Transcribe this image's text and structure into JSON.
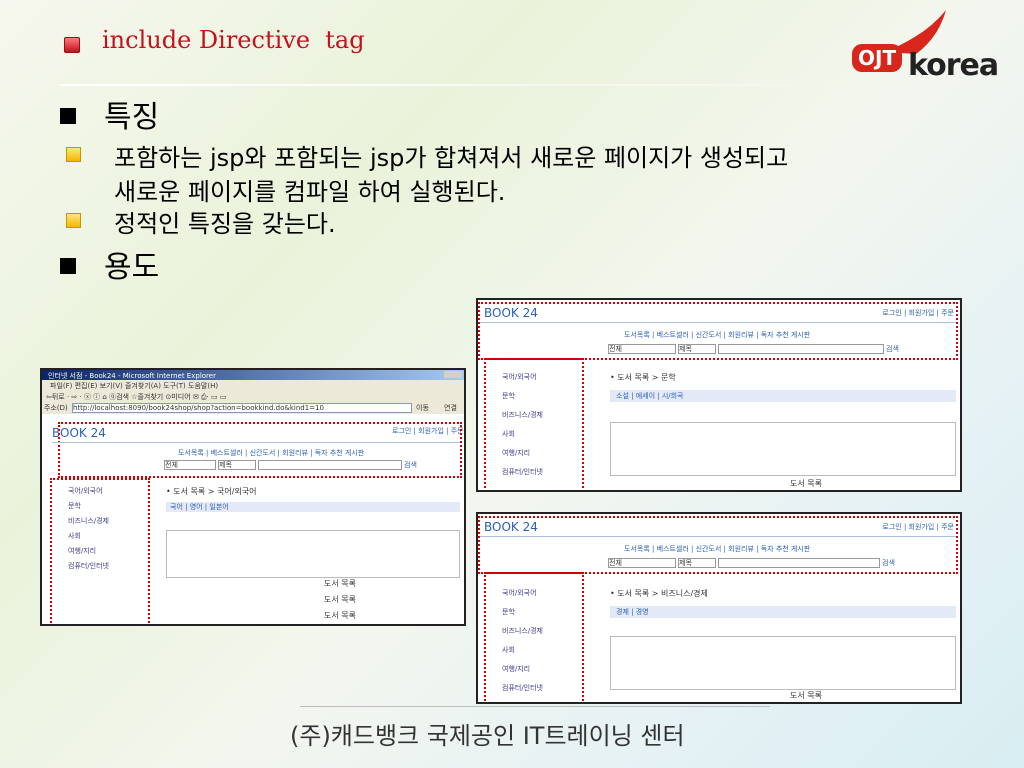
{
  "header": {
    "title": "include Directive  tag",
    "logo_left": "OJT",
    "logo_right": "korea"
  },
  "body": {
    "section1": "특징",
    "point1_line1": "포함하는 jsp와 포함되는 jsp가 합쳐져서 새로운 페이지가 생성되고",
    "point1_line2": "새로운 페이지를 컴파일 하여 실행된다.",
    "point2": "정적인 특징을 갖는다.",
    "section2": "용도"
  },
  "browser": {
    "window_title": "인터넷 서점 - Book24 - Microsoft Internet Explorer",
    "menu": "파일(F)  편집(E)  보기(V)  즐겨찾기(A)  도구(T)  도움말(H)",
    "toolbar": "⇦뒤로 · ⇨ · ⓧ ⓘ ⌂  ⓠ검색  ☆즐겨찾기  ⊙미디어  ✉ ⎙· ▭ ▭",
    "address_label": "주소(D)",
    "address": "http://localhost:8090/book24shop/shop?action=bookkind.do&kind1=10",
    "go_button": "이동",
    "links_button": "연결"
  },
  "site": {
    "logo": "BOOK 24",
    "top_links": "로그인 | 회원가입 | 주문",
    "nav": "도서목록   |   베스트셀러   |   신간도서   |   회원리뷰   |   독자 추천 게시판",
    "search_select1": "전체",
    "search_select2": "제목",
    "search_button": "검색",
    "categories": [
      "국어/외국어",
      "문학",
      "비즈니스/경제",
      "사회",
      "여행/지리",
      "컴퓨터/인터넷"
    ],
    "book_list": "도서 목록"
  },
  "shot1": {
    "breadcrumb": "• 도서 목록 > 국어/외국어",
    "subcats": "국어 | 영어 | 일본어",
    "list_rows": [
      "도서 목록",
      "도서 목록",
      "도서 목록"
    ]
  },
  "shot2": {
    "breadcrumb": "• 도서 목록 > 문학",
    "subcats": "소설 | 에세이 | 시/희곡"
  },
  "shot3": {
    "breadcrumb": "• 도서 목록 > 비즈니스/경제",
    "subcats": "경제 | 경영"
  },
  "footer": "(주)캐드뱅크 국제공인 IT트레이닝 센터",
  "colors": {
    "title_red": "#c8101c",
    "dash_red": "#d20000",
    "link_blue": "#2b5fb4"
  }
}
